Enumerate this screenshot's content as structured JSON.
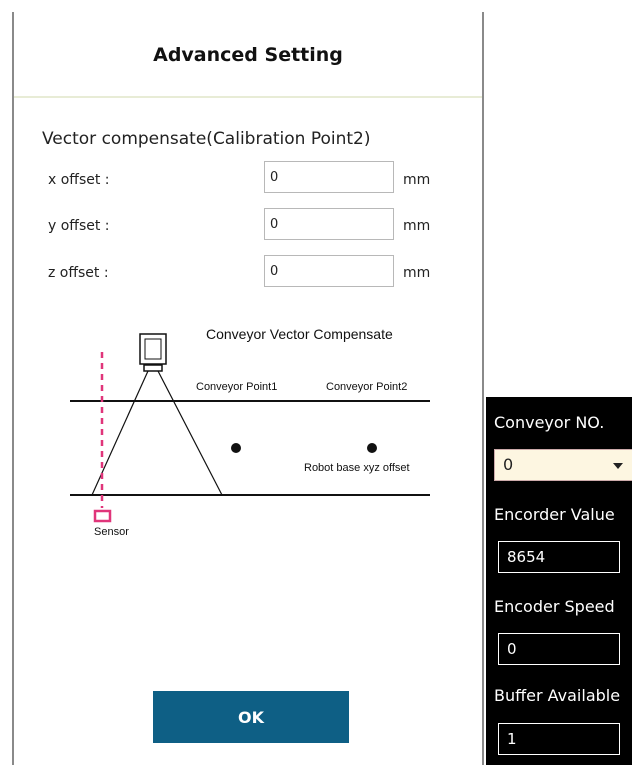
{
  "dialog": {
    "title": "Advanced Setting",
    "section_heading": "Vector compensate(Calibration Point2)",
    "fields": [
      {
        "label": "x offset :",
        "value": "0",
        "unit": "mm"
      },
      {
        "label": "y offset :",
        "value": "0",
        "unit": "mm"
      },
      {
        "label": "z offset :",
        "value": "0",
        "unit": "mm"
      }
    ],
    "diagram": {
      "title": "Conveyor Vector Compensate",
      "point1_label": "Conveyor Point1",
      "point2_label": "Conveyor Point2",
      "robot_label": "Robot base xyz offset",
      "sensor_label": "Sensor"
    },
    "ok_label": "OK"
  },
  "side_panel": {
    "conveyor_no_label": "Conveyor NO.",
    "conveyor_no_value": "0",
    "encoder_value_label": "Encorder Value",
    "encoder_value": "8654",
    "encoder_speed_label": "Encoder Speed",
    "encoder_speed": "0",
    "buffer_label": "Buffer Available",
    "buffer_value": "1"
  },
  "colors": {
    "ok_button": "#0e5f85",
    "sensor": "#e0357a",
    "side_panel_bg": "#000000",
    "select_bg": "#fdf6e1"
  }
}
